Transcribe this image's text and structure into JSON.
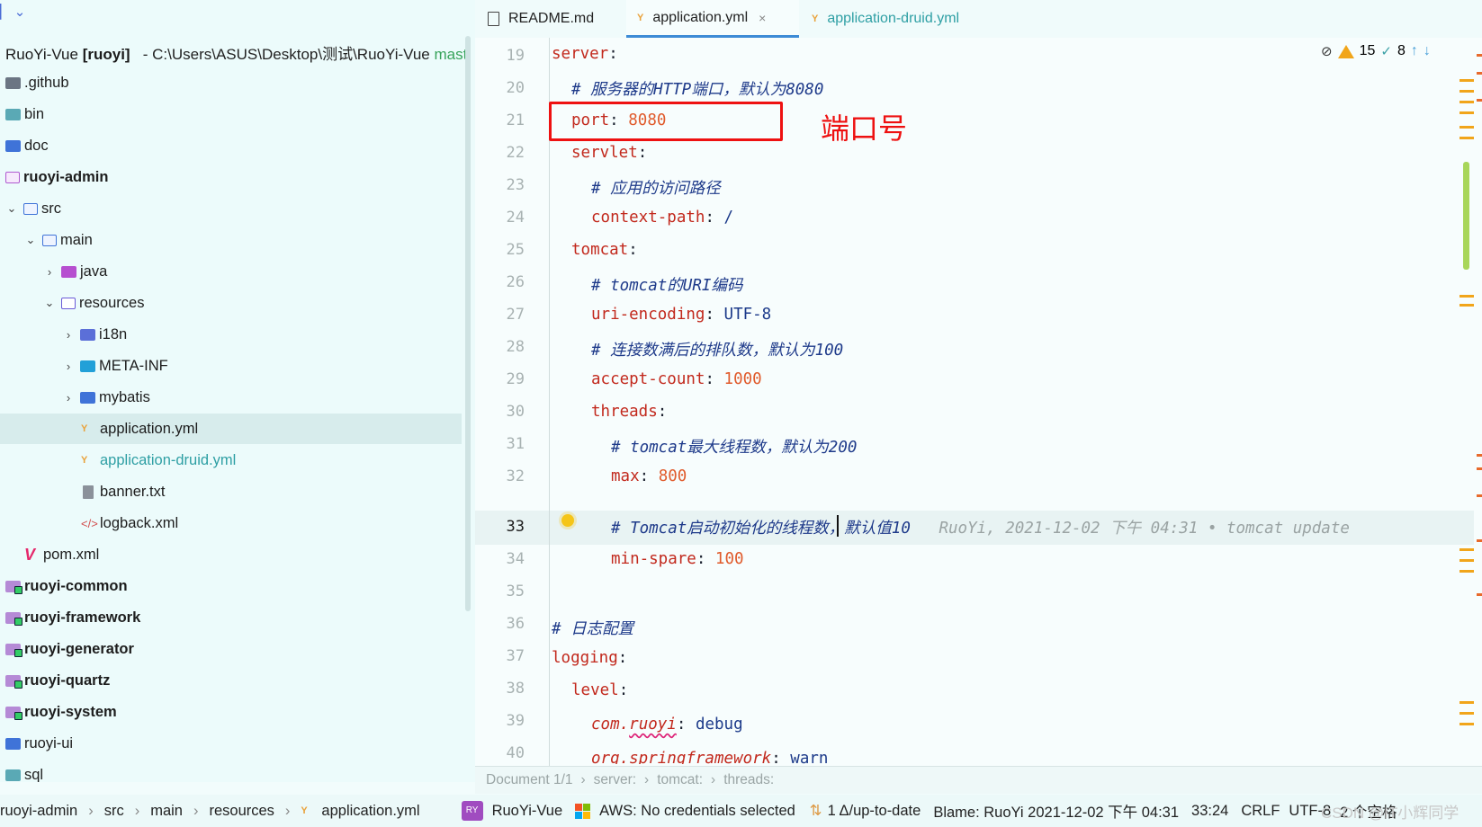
{
  "project": {
    "root": {
      "name": "RuoYi-Vue",
      "module": "[ruoyi]",
      "path": "- C:\\Users\\ASUS\\Desktop\\测试\\RuoYi-Vue",
      "branch": "mast"
    },
    "items": [
      {
        "label": ".github"
      },
      {
        "label": "bin"
      },
      {
        "label": "doc"
      },
      {
        "label": "ruoyi-admin"
      },
      {
        "label": "src"
      },
      {
        "label": "main"
      },
      {
        "label": "java"
      },
      {
        "label": "resources"
      },
      {
        "label": "i18n"
      },
      {
        "label": "META-INF"
      },
      {
        "label": "mybatis"
      },
      {
        "label": "application.yml"
      },
      {
        "label": "application-druid.yml"
      },
      {
        "label": "banner.txt"
      },
      {
        "label": "logback.xml"
      },
      {
        "label": "pom.xml"
      },
      {
        "label": "ruoyi-common"
      },
      {
        "label": "ruoyi-framework"
      },
      {
        "label": "ruoyi-generator"
      },
      {
        "label": "ruoyi-quartz"
      },
      {
        "label": "ruoyi-system"
      },
      {
        "label": "ruoyi-ui"
      },
      {
        "label": "sql"
      }
    ]
  },
  "tabs": [
    {
      "label": "README.md"
    },
    {
      "label": "application.yml",
      "close": "×"
    },
    {
      "label": "application-druid.yml"
    }
  ],
  "editor": {
    "line_numbers": [
      "19",
      "20",
      "21",
      "22",
      "23",
      "24",
      "25",
      "26",
      "27",
      "28",
      "29",
      "30",
      "31",
      "32",
      "33",
      "34",
      "35",
      "36",
      "37",
      "38",
      "39",
      "40"
    ],
    "lines": {
      "l19": {
        "key": "server",
        "colon": ":"
      },
      "l20": {
        "comment": "# 服务器的HTTP端口，默认为8080"
      },
      "l21": {
        "key": "port",
        "colon": ":",
        "value": "8080"
      },
      "l22": {
        "key": "servlet",
        "colon": ":"
      },
      "l23": {
        "comment": "# 应用的访问路径"
      },
      "l24": {
        "key": "context-path",
        "colon": ":",
        "value": "/"
      },
      "l25": {
        "key": "tomcat",
        "colon": ":"
      },
      "l26": {
        "comment": "# tomcat的URI编码"
      },
      "l27": {
        "key": "uri-encoding",
        "colon": ":",
        "value": "UTF-8"
      },
      "l28": {
        "comment": "# 连接数满后的排队数，默认为100"
      },
      "l29": {
        "key": "accept-count",
        "colon": ":",
        "value": "1000"
      },
      "l30": {
        "key": "threads",
        "colon": ":"
      },
      "l31": {
        "comment": "# tomcat最大线程数，默认为200"
      },
      "l32": {
        "key": "max",
        "colon": ":",
        "value": "800"
      },
      "l33": {
        "comment_a": "# Tomcat启动初始化的线程数",
        "comment_b": "，默认值10",
        "blame": "RuoYi, 2021-12-02 下午 04:31 • tomcat update"
      },
      "l34": {
        "key": "min-spare",
        "colon": ":",
        "value": "100"
      },
      "l36": {
        "comment": "# 日志配置"
      },
      "l37": {
        "key": "logging",
        "colon": ":"
      },
      "l38": {
        "key": "level",
        "colon": ":"
      },
      "l39": {
        "key_a": "com.",
        "key_b": "ruoyi",
        "colon": ":",
        "value": "debug"
      },
      "l40": {
        "key": "org.springframework",
        "colon": ":",
        "value": "warn"
      }
    },
    "annotation": "端口号",
    "inspections": {
      "warnings": "15",
      "typos": "8"
    }
  },
  "breadcrumb": [
    "Document 1/1",
    "›",
    "server:",
    "›",
    "tomcat:",
    "›",
    "threads:"
  ],
  "statusbar": {
    "path": [
      "ruoyi-admin",
      "›",
      "src",
      "›",
      "main",
      "›",
      "resources",
      "›",
      "application.yml"
    ],
    "project_badge": "RY",
    "project": "RuoYi-Vue",
    "aws": "AWS: No credentials selected",
    "vcs": "1 Δ/up-to-date",
    "blame": "Blame: RuoYi 2021-12-02 下午 04:31",
    "position": "33:24",
    "line_sep": "CRLF",
    "encoding": "UTF-8",
    "indent": "2 个空格",
    "watermark": "CSDN @IT小辉同学"
  },
  "colors": {
    "accent": "#3d8bd6",
    "highlight_box": "#ee1111",
    "key": "#c2291d",
    "number": "#e05b2c"
  }
}
